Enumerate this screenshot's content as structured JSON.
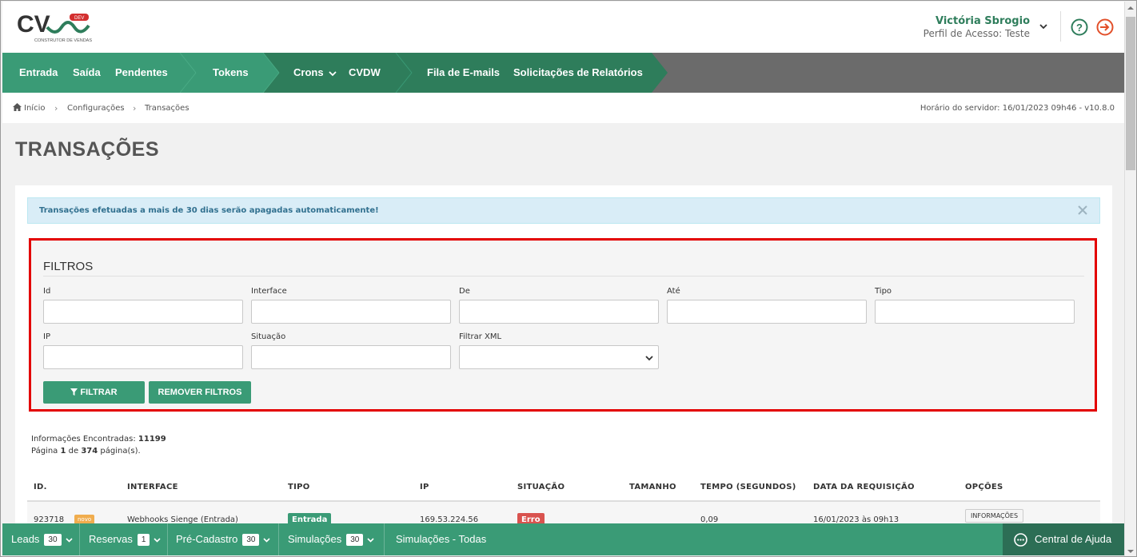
{
  "header": {
    "logo_text": "CV",
    "logo_badge": "DEV",
    "logo_subtitle": "CONSTRUTOR DE VENDAS",
    "user_name": "Victória Sbrogio",
    "user_profile": "Perfil de Acesso: Teste"
  },
  "nav": {
    "items": [
      {
        "label": "Entrada"
      },
      {
        "label": "Saída"
      },
      {
        "label": "Pendentes"
      },
      {
        "label": "Tokens"
      },
      {
        "label": "Crons"
      },
      {
        "label": "CVDW"
      },
      {
        "label": "Fila de E-mails"
      },
      {
        "label": "Solicitações de Relatórios"
      }
    ],
    "colors": {
      "dark": "#2e7d5b",
      "mid": "#3a9b76",
      "gray": "#6b6b6b"
    }
  },
  "breadcrumb": {
    "items": [
      "Início",
      "Configurações",
      "Transações"
    ],
    "server_time": "Horário do servidor: 16/01/2023 09h46 - v10.8.0"
  },
  "page": {
    "title": "TRANSAÇÕES",
    "alert": "Transações efetuadas a mais de 30 dias serão apagadas automaticamente!"
  },
  "filters": {
    "title": "FILTROS",
    "fields": [
      {
        "label": "Id",
        "value": ""
      },
      {
        "label": "Interface",
        "value": ""
      },
      {
        "label": "De",
        "value": ""
      },
      {
        "label": "Até",
        "value": ""
      },
      {
        "label": "Tipo",
        "value": ""
      },
      {
        "label": "IP",
        "value": ""
      },
      {
        "label": "Situação",
        "value": ""
      },
      {
        "label": "Filtrar XML",
        "value": ""
      }
    ],
    "filter_button": "FILTRAR",
    "remove_button": "REMOVER FILTROS"
  },
  "results": {
    "found_label": "Informações Encontradas:",
    "found_count": "11199",
    "page_label": "Página",
    "page_current": "1",
    "page_of": "de",
    "page_total": "374",
    "page_suffix": "página(s)."
  },
  "table": {
    "columns": [
      "ID.",
      "INTERFACE",
      "TIPO",
      "IP",
      "SITUAÇÃO",
      "TAMANHO",
      "TEMPO (SEGUNDOS)",
      "DATA DA REQUISIÇÃO",
      "OPÇÕES"
    ],
    "rows": [
      {
        "id": "923718",
        "badge": "novo",
        "interface": "Webhooks Sienge (Entrada)",
        "tipo": "Entrada",
        "ip": "169.53.224.56",
        "situacao": "Erro",
        "tamanho": "",
        "tempo": "0,09",
        "data": "16/01/2023 às 09h13",
        "opcoes": "INFORMAÇÕES"
      }
    ]
  },
  "bottombar": {
    "items": [
      {
        "label": "Leads",
        "count": "30"
      },
      {
        "label": "Reservas",
        "count": "1"
      },
      {
        "label": "Pré-Cadastro",
        "count": "30"
      },
      {
        "label": "Simulações",
        "count": "30"
      },
      {
        "label": "Simulações - Todas",
        "count": ""
      }
    ],
    "help_center": "Central de Ajuda"
  }
}
